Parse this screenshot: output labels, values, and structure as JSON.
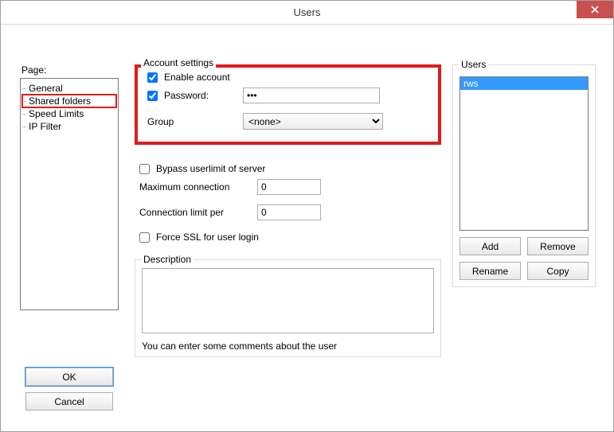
{
  "window": {
    "title": "Users"
  },
  "page": {
    "label": "Page:",
    "items": [
      "General",
      "Shared folders",
      "Speed Limits",
      "IP Filter"
    ],
    "highlighted_index": 1
  },
  "buttons": {
    "ok": "OK",
    "cancel": "Cancel"
  },
  "account": {
    "legend": "Account settings",
    "enable_label": "Enable account",
    "enable_checked": true,
    "password_label": "Password:",
    "password_checked": true,
    "password_value": "•••",
    "group_label": "Group",
    "group_value": "<none>"
  },
  "limits": {
    "bypass_label": "Bypass userlimit of server",
    "bypass_checked": false,
    "max_conn_label": "Maximum connection",
    "max_conn_value": "0",
    "conn_limit_label": "Connection limit per",
    "conn_limit_value": "0",
    "force_ssl_label": "Force SSL for user login",
    "force_ssl_checked": false
  },
  "description": {
    "legend": "Description",
    "value": "",
    "hint": "You can enter some comments about the user"
  },
  "users": {
    "legend": "Users",
    "items": [
      "rws"
    ],
    "add": "Add",
    "remove": "Remove",
    "rename": "Rename",
    "copy": "Copy"
  }
}
